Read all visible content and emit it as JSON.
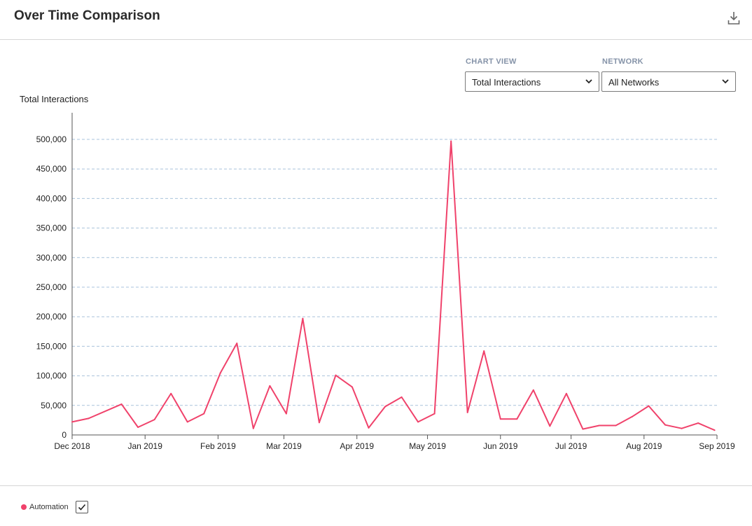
{
  "header": {
    "title": "Over Time Comparison",
    "download_icon": "download-icon"
  },
  "controls": {
    "chart_view": {
      "label": "CHART VIEW",
      "selected": "Total Interactions"
    },
    "network": {
      "label": "NETWORK",
      "selected": "All Networks"
    }
  },
  "legend": {
    "items": [
      {
        "label": "Automation",
        "color": "#f0426b",
        "checked": true
      }
    ]
  },
  "colors": {
    "series": "#f0426b",
    "grid": "#a9c3dc",
    "axis": "#555555"
  },
  "chart_data": {
    "type": "line",
    "ylabel": "Total Interactions",
    "ylim": [
      0,
      500000
    ],
    "yticks": [
      0,
      50000,
      100000,
      150000,
      200000,
      250000,
      300000,
      350000,
      400000,
      450000,
      500000
    ],
    "ytick_labels": [
      "0",
      "50,000",
      "100,000",
      "150,000",
      "200,000",
      "250,000",
      "300,000",
      "350,000",
      "400,000",
      "450,000",
      "500,000"
    ],
    "xlim": [
      "2018-12-01",
      "2019-09-01"
    ],
    "xtick_labels": [
      "Dec 2018",
      "Jan 2019",
      "Feb 2019",
      "Mar 2019",
      "Apr 2019",
      "May 2019",
      "Jun 2019",
      "Jul 2019",
      "Aug 2019",
      "Sep 2019"
    ],
    "xtick_dates": [
      "2018-12-01",
      "2019-01-01",
      "2019-02-01",
      "2019-03-01",
      "2019-04-01",
      "2019-05-01",
      "2019-06-01",
      "2019-07-01",
      "2019-08-01",
      "2019-09-01"
    ],
    "grid": true,
    "series": [
      {
        "name": "Automation",
        "x": [
          "2018-12-01",
          "2018-12-08",
          "2018-12-22",
          "2018-12-29",
          "2019-01-05",
          "2019-01-12",
          "2019-01-19",
          "2019-01-26",
          "2019-02-02",
          "2019-02-09",
          "2019-02-16",
          "2019-02-23",
          "2019-03-02",
          "2019-03-09",
          "2019-03-16",
          "2019-03-23",
          "2019-03-30",
          "2019-04-06",
          "2019-04-13",
          "2019-04-20",
          "2019-04-27",
          "2019-05-04",
          "2019-05-11",
          "2019-05-18",
          "2019-05-25",
          "2019-06-01",
          "2019-06-08",
          "2019-06-15",
          "2019-06-22",
          "2019-06-29",
          "2019-07-06",
          "2019-07-13",
          "2019-07-20",
          "2019-07-27",
          "2019-08-03",
          "2019-08-10",
          "2019-08-17",
          "2019-08-24",
          "2019-08-31"
        ],
        "values": [
          22000,
          28000,
          52000,
          13000,
          26000,
          70000,
          22000,
          36000,
          105000,
          155000,
          11000,
          83000,
          36000,
          197000,
          21000,
          101000,
          81000,
          12000,
          48000,
          64000,
          22000,
          36000,
          497000,
          38000,
          142000,
          27000,
          27000,
          76000,
          15000,
          70000,
          10000,
          16000,
          16000,
          31000,
          49000,
          17000,
          11000,
          20000,
          8000
        ]
      }
    ]
  }
}
